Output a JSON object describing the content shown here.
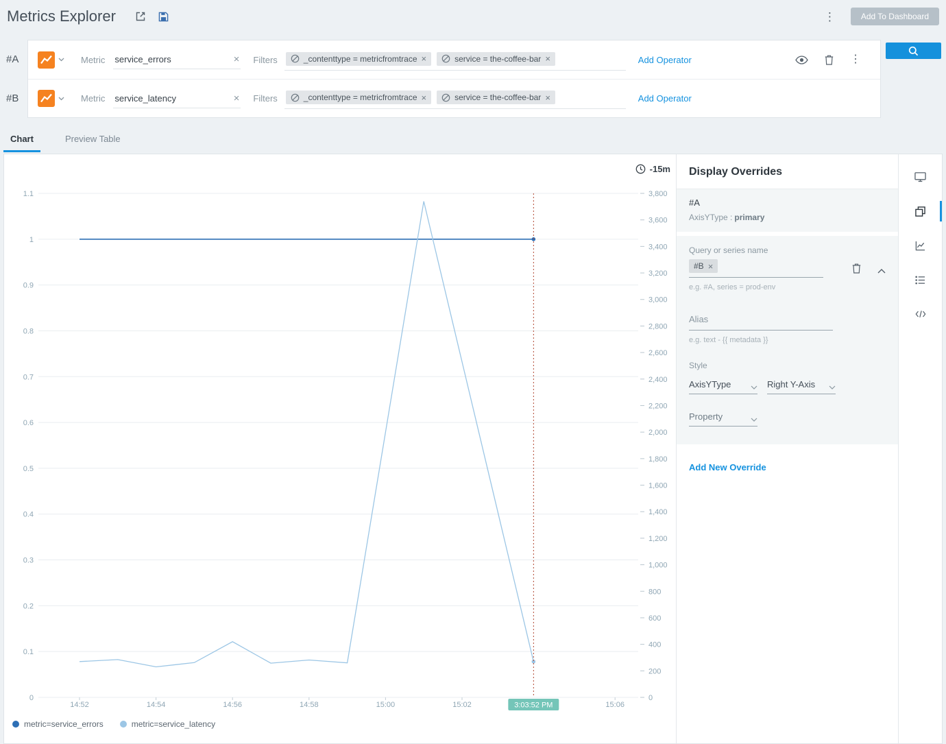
{
  "header": {
    "title": "Metrics Explorer",
    "add_to_dashboard_label": "Add To Dashboard"
  },
  "icons": {
    "close": "×",
    "kebab": "⋮"
  },
  "query_panel": {
    "rows": [
      {
        "id": "#A",
        "metric_label": "Metric",
        "metric_value": "service_errors",
        "filters_label": "Filters",
        "filters": [
          "_contenttype = metricfromtrace",
          "service = the-coffee-bar"
        ],
        "add_operator_label": "Add Operator"
      },
      {
        "id": "#B",
        "metric_label": "Metric",
        "metric_value": "service_latency",
        "filters_label": "Filters",
        "filters": [
          "_contenttype = metricfromtrace",
          "service = the-coffee-bar"
        ],
        "add_operator_label": "Add Operator"
      }
    ]
  },
  "tabs": {
    "chart": "Chart",
    "preview_table": "Preview Table"
  },
  "chart": {
    "time_range_label": "-15m"
  },
  "chart_data": {
    "type": "line",
    "x_axis": {
      "unit": "minutes after 14:52",
      "ticks": [
        {
          "t": 0,
          "label": "14:52"
        },
        {
          "t": 2,
          "label": "14:54"
        },
        {
          "t": 4,
          "label": "14:56"
        },
        {
          "t": 6,
          "label": "14:58"
        },
        {
          "t": 8,
          "label": "15:00"
        },
        {
          "t": 10,
          "label": "15:02"
        },
        {
          "t": 14,
          "label": "15:06"
        }
      ]
    },
    "left_axis": {
      "min": 0,
      "max": 1.1,
      "ticks": [
        {
          "v": 0,
          "label": "0"
        },
        {
          "v": 0.1,
          "label": "0.1"
        },
        {
          "v": 0.2,
          "label": "0.2"
        },
        {
          "v": 0.3,
          "label": "0.3"
        },
        {
          "v": 0.4,
          "label": "0.4"
        },
        {
          "v": 0.5,
          "label": "0.5"
        },
        {
          "v": 0.6,
          "label": "0.6"
        },
        {
          "v": 0.7,
          "label": "0.7"
        },
        {
          "v": 0.8,
          "label": "0.8"
        },
        {
          "v": 0.9,
          "label": "0.9"
        },
        {
          "v": 1,
          "label": "1"
        },
        {
          "v": 1.1,
          "label": "1.1"
        }
      ]
    },
    "right_axis": {
      "min": 0,
      "max": 3800,
      "step": 200
    },
    "cursor": {
      "t": 11.87,
      "label": "3:03:52 PM"
    },
    "series": [
      {
        "name": "metric=service_errors",
        "axis": "left",
        "color": "#2d6fb5",
        "points": [
          [
            0,
            1
          ],
          [
            11.87,
            1
          ]
        ]
      },
      {
        "name": "metric=service_latency",
        "axis": "right",
        "color": "#9cc6e5",
        "points": [
          [
            0,
            270
          ],
          [
            1,
            285
          ],
          [
            2,
            230
          ],
          [
            3,
            262
          ],
          [
            4,
            420
          ],
          [
            5,
            258
          ],
          [
            6,
            282
          ],
          [
            7,
            260
          ],
          [
            8,
            2000
          ],
          [
            9,
            3740
          ],
          [
            10,
            2530
          ],
          [
            11,
            1320
          ],
          [
            11.87,
            270
          ]
        ]
      }
    ],
    "cursor_line_color": "#b0432f",
    "cursor_chip_color": "#74c5b8",
    "grid_color": "#e9edf0",
    "axis_label_color": "#8fa6b4"
  },
  "overrides_panel": {
    "title": "Display Overrides",
    "applied_override": {
      "query": "#A",
      "detail_prefix": "AxisYType :",
      "detail_value": "primary"
    },
    "editor": {
      "query_label": "Query or series name",
      "query_chip": "#B",
      "query_hint": "e.g. #A, series = prod-env",
      "alias_label": "Alias",
      "alias_hint": "e.g. text - {{ metadata }}",
      "style_label": "Style",
      "axis_type_select": "AxisYType",
      "axis_value_select": "Right Y-Axis",
      "property_select": "Property"
    },
    "add_new_label": "Add New Override"
  }
}
